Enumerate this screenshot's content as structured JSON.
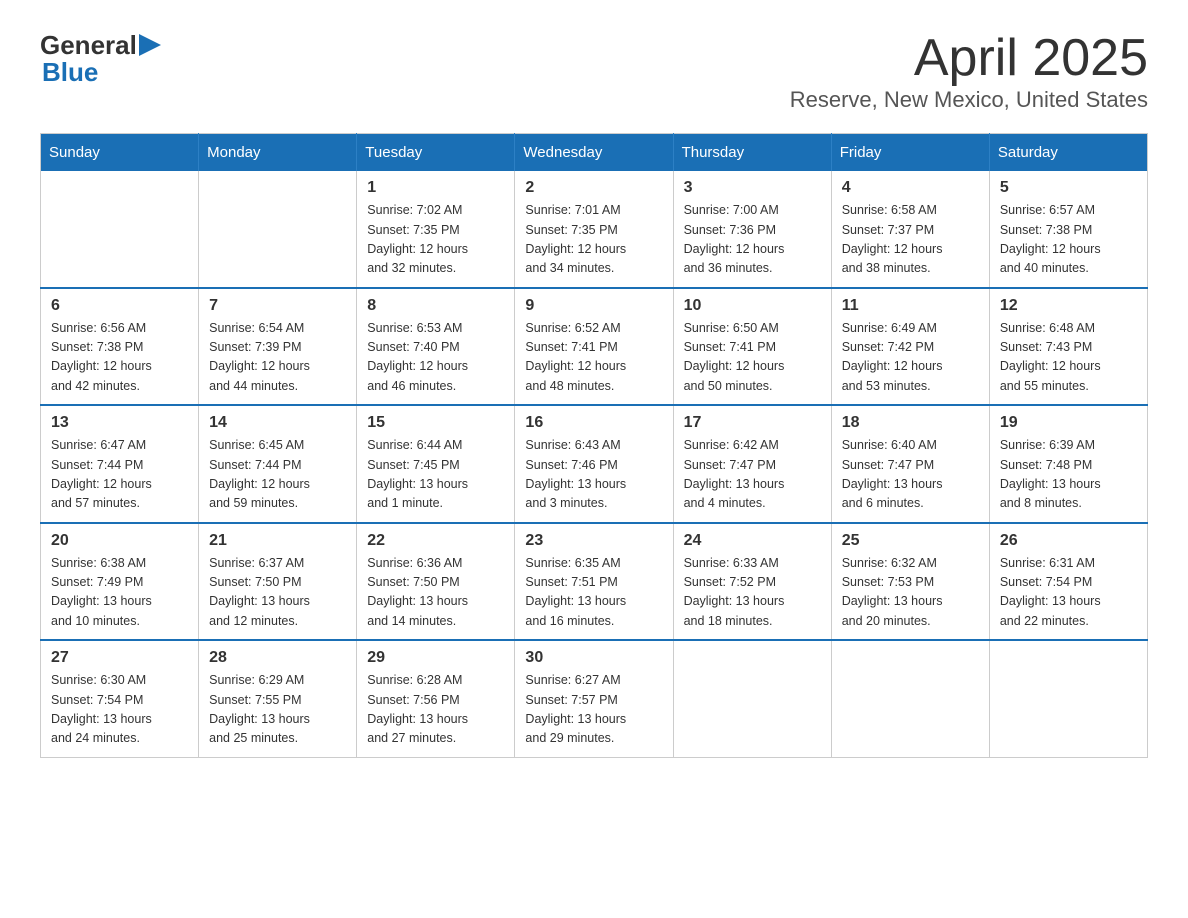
{
  "header": {
    "title": "April 2025",
    "subtitle": "Reserve, New Mexico, United States",
    "logo_general": "General",
    "logo_blue": "Blue"
  },
  "calendar": {
    "days_of_week": [
      "Sunday",
      "Monday",
      "Tuesday",
      "Wednesday",
      "Thursday",
      "Friday",
      "Saturday"
    ],
    "weeks": [
      [
        {
          "day": "",
          "info": ""
        },
        {
          "day": "",
          "info": ""
        },
        {
          "day": "1",
          "info": "Sunrise: 7:02 AM\nSunset: 7:35 PM\nDaylight: 12 hours\nand 32 minutes."
        },
        {
          "day": "2",
          "info": "Sunrise: 7:01 AM\nSunset: 7:35 PM\nDaylight: 12 hours\nand 34 minutes."
        },
        {
          "day": "3",
          "info": "Sunrise: 7:00 AM\nSunset: 7:36 PM\nDaylight: 12 hours\nand 36 minutes."
        },
        {
          "day": "4",
          "info": "Sunrise: 6:58 AM\nSunset: 7:37 PM\nDaylight: 12 hours\nand 38 minutes."
        },
        {
          "day": "5",
          "info": "Sunrise: 6:57 AM\nSunset: 7:38 PM\nDaylight: 12 hours\nand 40 minutes."
        }
      ],
      [
        {
          "day": "6",
          "info": "Sunrise: 6:56 AM\nSunset: 7:38 PM\nDaylight: 12 hours\nand 42 minutes."
        },
        {
          "day": "7",
          "info": "Sunrise: 6:54 AM\nSunset: 7:39 PM\nDaylight: 12 hours\nand 44 minutes."
        },
        {
          "day": "8",
          "info": "Sunrise: 6:53 AM\nSunset: 7:40 PM\nDaylight: 12 hours\nand 46 minutes."
        },
        {
          "day": "9",
          "info": "Sunrise: 6:52 AM\nSunset: 7:41 PM\nDaylight: 12 hours\nand 48 minutes."
        },
        {
          "day": "10",
          "info": "Sunrise: 6:50 AM\nSunset: 7:41 PM\nDaylight: 12 hours\nand 50 minutes."
        },
        {
          "day": "11",
          "info": "Sunrise: 6:49 AM\nSunset: 7:42 PM\nDaylight: 12 hours\nand 53 minutes."
        },
        {
          "day": "12",
          "info": "Sunrise: 6:48 AM\nSunset: 7:43 PM\nDaylight: 12 hours\nand 55 minutes."
        }
      ],
      [
        {
          "day": "13",
          "info": "Sunrise: 6:47 AM\nSunset: 7:44 PM\nDaylight: 12 hours\nand 57 minutes."
        },
        {
          "day": "14",
          "info": "Sunrise: 6:45 AM\nSunset: 7:44 PM\nDaylight: 12 hours\nand 59 minutes."
        },
        {
          "day": "15",
          "info": "Sunrise: 6:44 AM\nSunset: 7:45 PM\nDaylight: 13 hours\nand 1 minute."
        },
        {
          "day": "16",
          "info": "Sunrise: 6:43 AM\nSunset: 7:46 PM\nDaylight: 13 hours\nand 3 minutes."
        },
        {
          "day": "17",
          "info": "Sunrise: 6:42 AM\nSunset: 7:47 PM\nDaylight: 13 hours\nand 4 minutes."
        },
        {
          "day": "18",
          "info": "Sunrise: 6:40 AM\nSunset: 7:47 PM\nDaylight: 13 hours\nand 6 minutes."
        },
        {
          "day": "19",
          "info": "Sunrise: 6:39 AM\nSunset: 7:48 PM\nDaylight: 13 hours\nand 8 minutes."
        }
      ],
      [
        {
          "day": "20",
          "info": "Sunrise: 6:38 AM\nSunset: 7:49 PM\nDaylight: 13 hours\nand 10 minutes."
        },
        {
          "day": "21",
          "info": "Sunrise: 6:37 AM\nSunset: 7:50 PM\nDaylight: 13 hours\nand 12 minutes."
        },
        {
          "day": "22",
          "info": "Sunrise: 6:36 AM\nSunset: 7:50 PM\nDaylight: 13 hours\nand 14 minutes."
        },
        {
          "day": "23",
          "info": "Sunrise: 6:35 AM\nSunset: 7:51 PM\nDaylight: 13 hours\nand 16 minutes."
        },
        {
          "day": "24",
          "info": "Sunrise: 6:33 AM\nSunset: 7:52 PM\nDaylight: 13 hours\nand 18 minutes."
        },
        {
          "day": "25",
          "info": "Sunrise: 6:32 AM\nSunset: 7:53 PM\nDaylight: 13 hours\nand 20 minutes."
        },
        {
          "day": "26",
          "info": "Sunrise: 6:31 AM\nSunset: 7:54 PM\nDaylight: 13 hours\nand 22 minutes."
        }
      ],
      [
        {
          "day": "27",
          "info": "Sunrise: 6:30 AM\nSunset: 7:54 PM\nDaylight: 13 hours\nand 24 minutes."
        },
        {
          "day": "28",
          "info": "Sunrise: 6:29 AM\nSunset: 7:55 PM\nDaylight: 13 hours\nand 25 minutes."
        },
        {
          "day": "29",
          "info": "Sunrise: 6:28 AM\nSunset: 7:56 PM\nDaylight: 13 hours\nand 27 minutes."
        },
        {
          "day": "30",
          "info": "Sunrise: 6:27 AM\nSunset: 7:57 PM\nDaylight: 13 hours\nand 29 minutes."
        },
        {
          "day": "",
          "info": ""
        },
        {
          "day": "",
          "info": ""
        },
        {
          "day": "",
          "info": ""
        }
      ]
    ]
  }
}
